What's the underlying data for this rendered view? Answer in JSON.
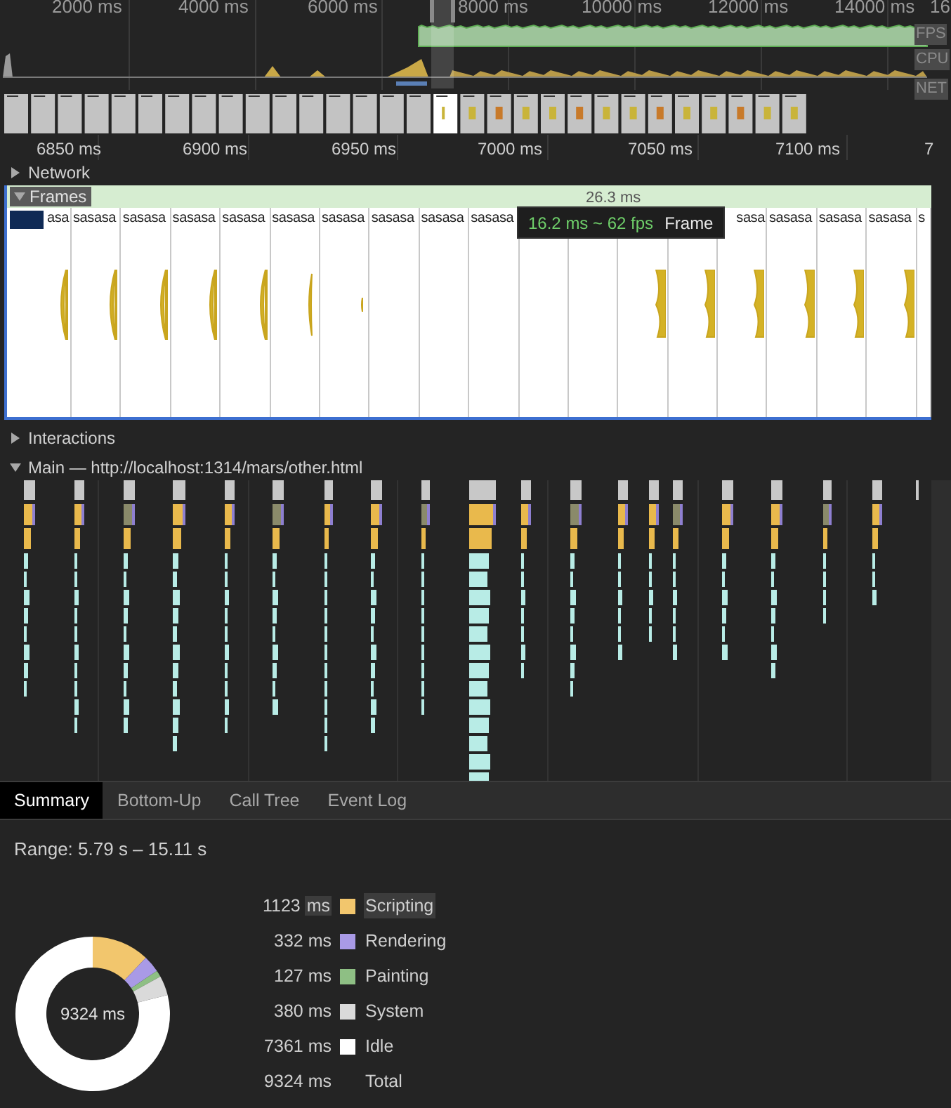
{
  "overview": {
    "ticks": [
      "2000 ms",
      "4000 ms",
      "6000 ms",
      "8000 ms",
      "10000 ms",
      "12000 ms",
      "14000 ms",
      "16"
    ],
    "tracks": [
      "FPS",
      "CPU",
      "NET"
    ]
  },
  "ruler": {
    "ticks": [
      "6850 ms",
      "6900 ms",
      "6950 ms",
      "7000 ms",
      "7050 ms",
      "7100 ms",
      "7"
    ]
  },
  "network": {
    "label": "Network",
    "expanded": false
  },
  "frames": {
    "label": "Frames",
    "expanded": true,
    "duration": "26.3 ms",
    "cells": [
      {
        "text": "asa",
        "covered": true,
        "kind": "crescent"
      },
      {
        "text": "sasasa",
        "covered": false,
        "kind": "crescent"
      },
      {
        "text": "sasasa",
        "covered": false,
        "kind": "crescent"
      },
      {
        "text": "sasasa",
        "covered": false,
        "kind": "crescent"
      },
      {
        "text": "sasasa",
        "covered": false,
        "kind": "crescent"
      },
      {
        "text": "sasasa",
        "covered": false,
        "kind": "sliver"
      },
      {
        "text": "sasasa",
        "covered": false,
        "kind": "dot"
      },
      {
        "text": "sasasa",
        "covered": false,
        "kind": "blank"
      },
      {
        "text": "sasasa",
        "covered": false,
        "kind": "blank"
      },
      {
        "text": "sasasa",
        "covered": false,
        "kind": "blank"
      },
      {
        "kind": "blank"
      },
      {
        "kind": "blank"
      },
      {
        "kind": "split"
      },
      {
        "kind": "split"
      },
      {
        "text": "sasa",
        "covered": true,
        "kind": "split"
      },
      {
        "text": "sasasa",
        "covered": false,
        "kind": "split"
      },
      {
        "text": "sasasa",
        "covered": false,
        "kind": "split"
      },
      {
        "text": "sasasa",
        "covered": false,
        "kind": "split"
      },
      {
        "text": "s",
        "covered": false,
        "kind": "blank"
      }
    ]
  },
  "tooltip": {
    "timing": "16.2 ms ~ 62 fps",
    "label": "Frame"
  },
  "interactions": {
    "label": "Interactions",
    "expanded": false
  },
  "main": {
    "label": "Main — http://localhost:1314/mars/other.html",
    "expanded": true
  },
  "tabs": [
    {
      "label": "Summary",
      "selected": true
    },
    {
      "label": "Bottom-Up",
      "selected": false
    },
    {
      "label": "Call Tree",
      "selected": false
    },
    {
      "label": "Event Log",
      "selected": false
    }
  ],
  "summary": {
    "range": "Range: 5.79 s – 15.11 s",
    "center": "9324 ms",
    "legend": [
      {
        "value": "1123 ms",
        "label": "Scripting",
        "color": "#f2c66d",
        "highlighted": true
      },
      {
        "value": "332 ms",
        "label": "Rendering",
        "color": "#a99ae6",
        "highlighted": false
      },
      {
        "value": "127 ms",
        "label": "Painting",
        "color": "#8ebf84",
        "highlighted": false
      },
      {
        "value": "380 ms",
        "label": "System",
        "color": "#dadada",
        "highlighted": false
      },
      {
        "value": "7361 ms",
        "label": "Idle",
        "color": "#ffffff",
        "highlighted": false
      }
    ],
    "total": {
      "value": "9324 ms",
      "label": "Total"
    },
    "chart_data": {
      "type": "donut",
      "series": [
        {
          "values": [
            12.05,
            3.56,
            1.36,
            4.08,
            78.95
          ]
        }
      ]
    }
  }
}
